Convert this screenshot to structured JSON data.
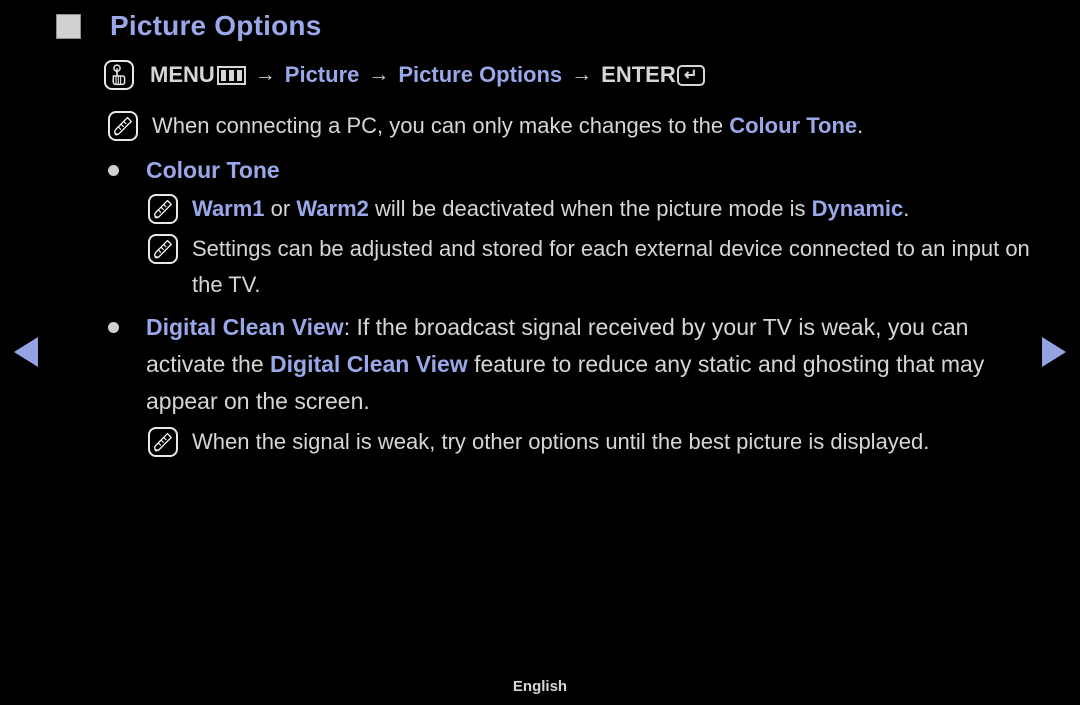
{
  "title": {
    "text": "Picture Options",
    "bullet_icon": "square-bullet-icon",
    "color": "#9aa7e8"
  },
  "path": {
    "remote_icon": "hand-press-icon",
    "menu_label": "MENU",
    "menu_icon": "menu-grid-icon",
    "arrow": "→",
    "step1": "Picture",
    "step2": "Picture Options",
    "enter_label": "ENTER",
    "enter_icon": "enter-return-icon"
  },
  "notes": {
    "pc_note": {
      "icon": "note-pencil-icon",
      "part1": "When connecting a PC, you can only make changes to the ",
      "highlight": "Colour Tone",
      "part2": "."
    },
    "warm_note": {
      "icon": "note-pencil-icon",
      "seg1": "Warm1",
      "seg2": " or ",
      "seg3": "Warm2",
      "seg4": " will be deactivated when the picture mode is ",
      "seg5": "Dynamic",
      "seg6": "."
    },
    "settings_note": {
      "icon": "note-pencil-icon",
      "text": "Settings can be adjusted and stored for each external device connected to an input on the TV."
    },
    "weak_signal_note": {
      "icon": "note-pencil-icon",
      "text": "When the signal is weak, try other options until the best picture is displayed."
    }
  },
  "bullets": {
    "colour_tone": {
      "label": "Colour Tone"
    },
    "digital_clean_view": {
      "label": "Digital Clean View",
      "part1": ": If the broadcast signal received by your TV is weak, you can activate the ",
      "highlight2": "Digital Clean View",
      "part2": " feature to reduce any static and ghosting that may appear on the screen."
    }
  },
  "nav": {
    "prev_label": "previous-page",
    "prev_icon": "triangle-left-icon",
    "next_label": "next-page",
    "next_icon": "triangle-right-icon",
    "color": "#93a4e0"
  },
  "footer": {
    "language": "English"
  }
}
